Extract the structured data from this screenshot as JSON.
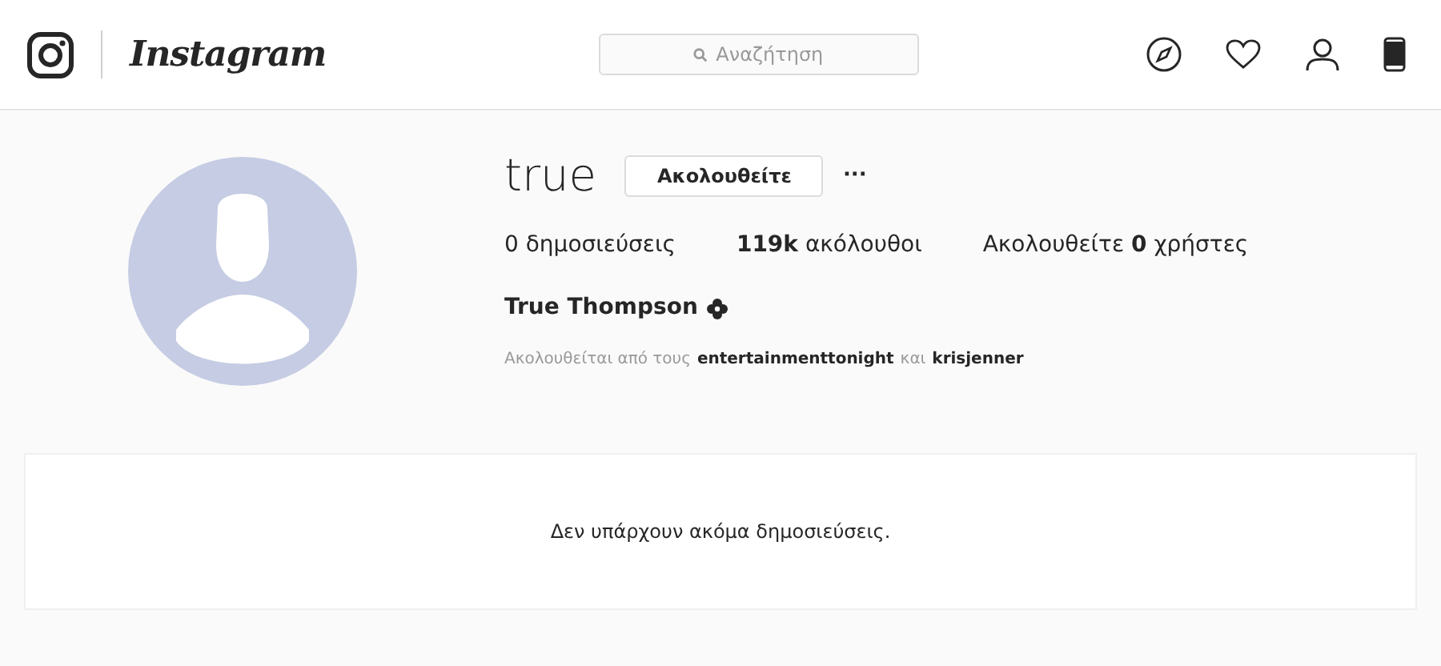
{
  "header": {
    "logo_text": "Instagram",
    "search": {
      "placeholder": "Αναζήτηση"
    }
  },
  "profile": {
    "username": "true",
    "follow_button": "Ακολουθείτε",
    "more_button": "···",
    "stats": [
      "0 δημοσιεύσεις",
      "**119k** ακόλουθοι",
      "Ακολουθείτε **0** χρήστες"
    ],
    "full_name": "True Thompson",
    "followed_by": [
      {
        "kind": "text",
        "text": "Ακολουθείται από τους"
      },
      {
        "kind": "link",
        "text": "entertainmenttonight"
      },
      {
        "kind": "text",
        "text": "και"
      },
      {
        "kind": "link",
        "text": "krisjenner"
      }
    ]
  },
  "posts": {
    "empty_message": "Δεν υπάρχουν ακόμα δημοσιεύσεις."
  }
}
